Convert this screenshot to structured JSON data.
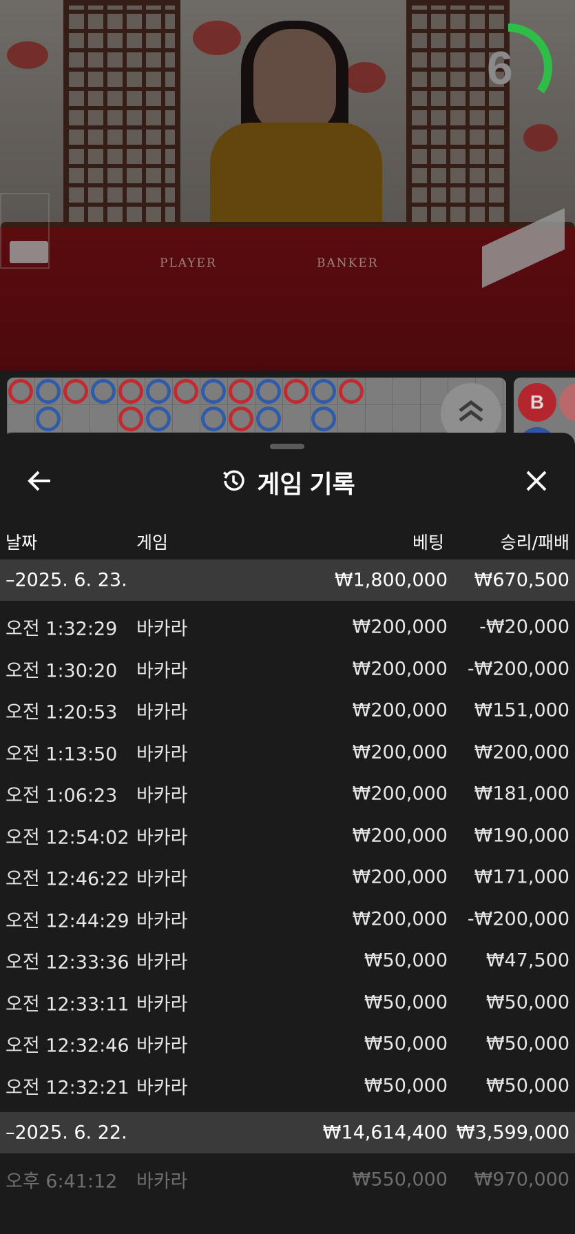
{
  "video": {
    "table_labels": {
      "player": "PLAYER",
      "banker": "BANKER"
    },
    "timer": {
      "seconds": "6",
      "remaining_fraction": 0.35,
      "color": "#2fbd47"
    }
  },
  "roadmap": {
    "beads": [
      {
        "col": 0,
        "row": 0,
        "side": "banker"
      },
      {
        "col": 1,
        "row": 0,
        "side": "player"
      },
      {
        "col": 1,
        "row": 1,
        "side": "player"
      },
      {
        "col": 2,
        "row": 0,
        "side": "banker"
      },
      {
        "col": 3,
        "row": 0,
        "side": "player"
      },
      {
        "col": 4,
        "row": 0,
        "side": "banker"
      },
      {
        "col": 4,
        "row": 1,
        "side": "banker"
      },
      {
        "col": 5,
        "row": 0,
        "side": "player"
      },
      {
        "col": 5,
        "row": 1,
        "side": "player"
      },
      {
        "col": 6,
        "row": 0,
        "side": "banker"
      },
      {
        "col": 7,
        "row": 0,
        "side": "player"
      },
      {
        "col": 7,
        "row": 1,
        "side": "player"
      },
      {
        "col": 8,
        "row": 0,
        "side": "banker"
      },
      {
        "col": 8,
        "row": 1,
        "side": "banker"
      },
      {
        "col": 9,
        "row": 0,
        "side": "player"
      },
      {
        "col": 9,
        "row": 1,
        "side": "player"
      },
      {
        "col": 10,
        "row": 0,
        "side": "banker"
      },
      {
        "col": 11,
        "row": 0,
        "side": "player"
      },
      {
        "col": 11,
        "row": 1,
        "side": "player"
      },
      {
        "col": 12,
        "row": 0,
        "side": "banker"
      }
    ],
    "side_label": "B",
    "colors": {
      "banker": "#c02a31",
      "player": "#2f5ba8"
    }
  },
  "sheet": {
    "title": "게임 기록",
    "columns": {
      "date": "날짜",
      "game": "게임",
      "bet": "베팅",
      "result": "승리/패배"
    },
    "groups": [
      {
        "date": "–2025. 6. 23.",
        "total_bet": "₩1,800,000",
        "total_result": "₩670,500",
        "rows": [
          {
            "time": "오전 1:32:29",
            "game": "바카라",
            "bet": "₩200,000",
            "result": "-₩20,000"
          },
          {
            "time": "오전 1:30:20",
            "game": "바카라",
            "bet": "₩200,000",
            "result": "-₩200,000"
          },
          {
            "time": "오전 1:20:53",
            "game": "바카라",
            "bet": "₩200,000",
            "result": "₩151,000"
          },
          {
            "time": "오전 1:13:50",
            "game": "바카라",
            "bet": "₩200,000",
            "result": "₩200,000"
          },
          {
            "time": "오전 1:06:23",
            "game": "바카라",
            "bet": "₩200,000",
            "result": "₩181,000"
          },
          {
            "time": "오전 12:54:02",
            "game": "바카라",
            "bet": "₩200,000",
            "result": "₩190,000"
          },
          {
            "time": "오전 12:46:22",
            "game": "바카라",
            "bet": "₩200,000",
            "result": "₩171,000"
          },
          {
            "time": "오전 12:44:29",
            "game": "바카라",
            "bet": "₩200,000",
            "result": "-₩200,000"
          },
          {
            "time": "오전 12:33:36",
            "game": "바카라",
            "bet": "₩50,000",
            "result": "₩47,500"
          },
          {
            "time": "오전 12:33:11",
            "game": "바카라",
            "bet": "₩50,000",
            "result": "₩50,000"
          },
          {
            "time": "오전 12:32:46",
            "game": "바카라",
            "bet": "₩50,000",
            "result": "₩50,000"
          },
          {
            "time": "오전 12:32:21",
            "game": "바카라",
            "bet": "₩50,000",
            "result": "₩50,000"
          }
        ]
      },
      {
        "date": "–2025. 6. 22.",
        "total_bet": "₩14,614,400",
        "total_result": "₩3,599,000",
        "rows": [
          {
            "time": "오후 6:41:12",
            "game": "바카라",
            "bet": "₩550,000",
            "result": "₩970,000",
            "faded": true
          }
        ]
      }
    ]
  },
  "icons": {
    "back": "arrow-left-icon",
    "history": "history-clock-icon",
    "close": "close-x-icon",
    "scroll_up": "double-chevron-up-icon"
  }
}
